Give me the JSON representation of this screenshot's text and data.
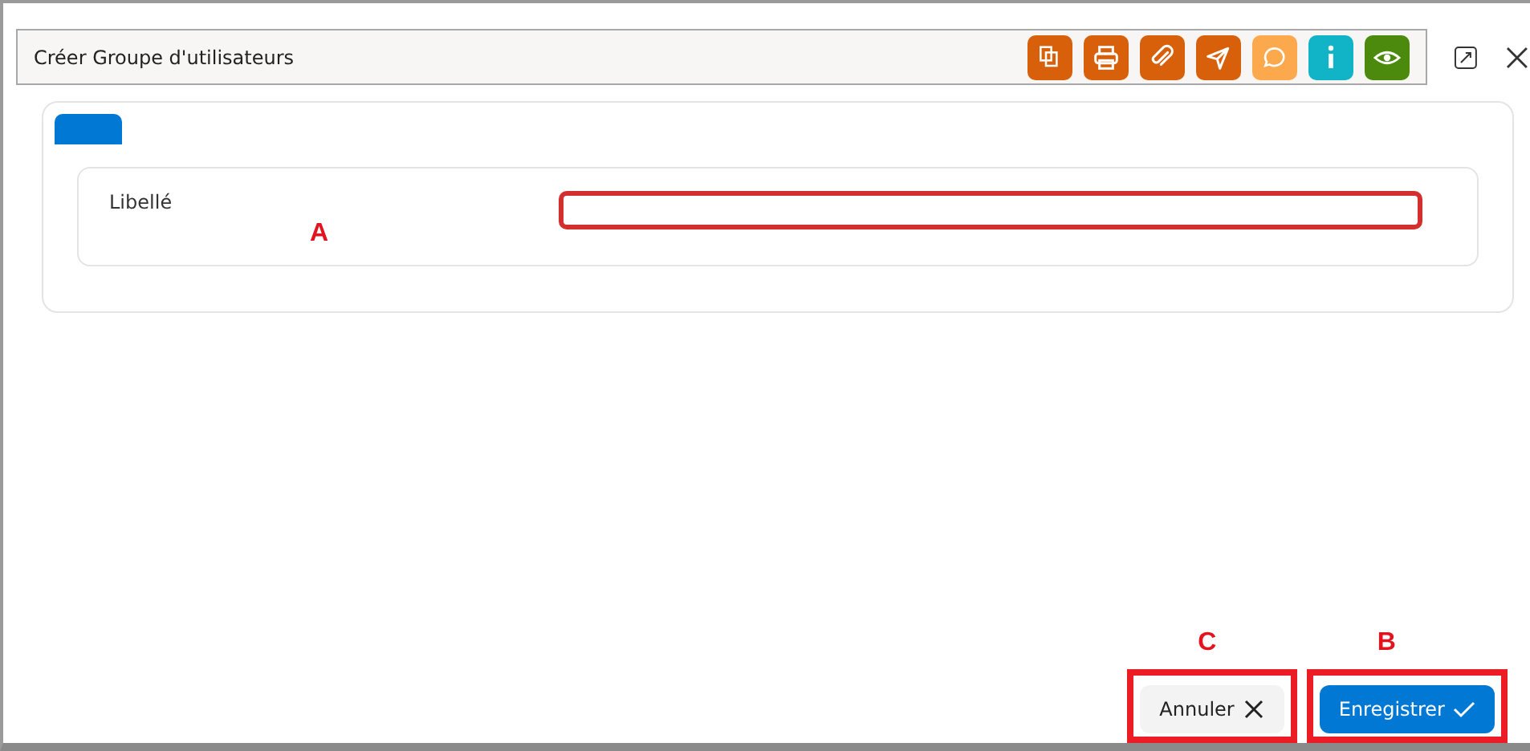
{
  "dialog": {
    "title": "Créer Groupe d'utilisateurs",
    "toolbar": [
      {
        "kind": "documents",
        "color": "#d9600b"
      },
      {
        "kind": "print",
        "color": "#d9600b"
      },
      {
        "kind": "attach",
        "color": "#d9600b"
      },
      {
        "kind": "send",
        "color": "#d9600b"
      },
      {
        "kind": "comment",
        "color": "#fba94c"
      },
      {
        "kind": "info",
        "color": "#11b4c6"
      },
      {
        "kind": "preview",
        "color": "#4b8a0c"
      }
    ]
  },
  "tabs": [
    {
      "selected": true
    }
  ],
  "fields": [
    {
      "label": "Libellé",
      "invalid": true,
      "callout": "A"
    }
  ],
  "buttons": [
    {
      "kind": "cancel",
      "label": "Annuler",
      "callout": "C"
    },
    {
      "kind": "save",
      "label": "Enregistrer",
      "callout": "B"
    }
  ]
}
